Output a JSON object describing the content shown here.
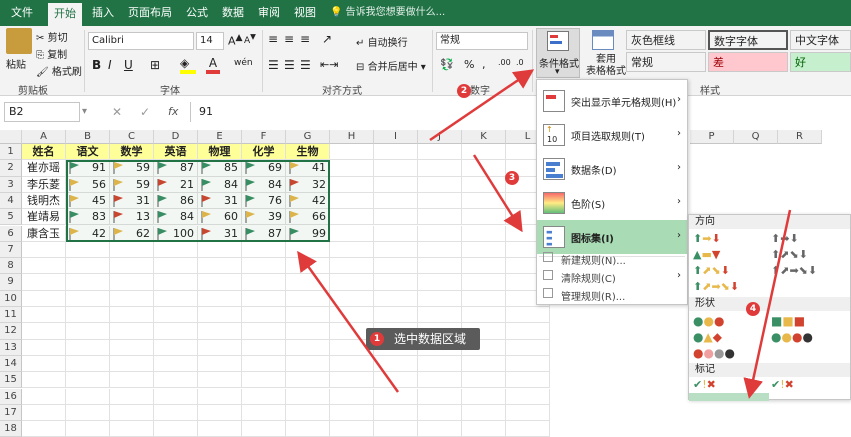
{
  "tabs": [
    "文件",
    "开始",
    "插入",
    "页面布局",
    "公式",
    "数据",
    "审阅",
    "视图"
  ],
  "tell_me": "告诉我您想要做什么...",
  "ribbon": {
    "paste": "粘贴",
    "cut": "剪切",
    "copy": "复制",
    "format_painter": "格式刷",
    "clipboard": "剪贴板",
    "font_name": "Calibri",
    "font_size": "14",
    "font_group": "字体",
    "wrap": "自动换行",
    "merge": "合并后居中",
    "align_group": "对齐方式",
    "number_format": "常规",
    "number_group": "数字",
    "cond_format": "条件格式",
    "table_format": "套用\n表格格式",
    "styles_group": "样式",
    "styles": [
      {
        "label": "灰色框线",
        "bg": "#ffffff",
        "color": "#222222"
      },
      {
        "label": "数字字体",
        "bg": "#ffffff",
        "color": "#222222"
      },
      {
        "label": "中文字体",
        "bg": "#ffffff",
        "color": "#222222"
      },
      {
        "label": "常规",
        "bg": "#ffffff",
        "color": "#222222"
      },
      {
        "label": "差",
        "bg": "#ffc7ce",
        "color": "#9c0006"
      },
      {
        "label": "好",
        "bg": "#c6efce",
        "color": "#006100"
      }
    ]
  },
  "formula_bar": {
    "name_box": "B2",
    "value": "91"
  },
  "columns": [
    "A",
    "B",
    "C",
    "D",
    "E",
    "F",
    "G",
    "H",
    "I",
    "J",
    "K",
    "L"
  ],
  "rows": [
    "1",
    "2",
    "3",
    "4",
    "5",
    "6",
    "7",
    "8",
    "9",
    "10",
    "11",
    "12",
    "13",
    "14",
    "15",
    "16",
    "17",
    "18"
  ],
  "table": {
    "headers": [
      "姓名",
      "语文",
      "数学",
      "英语",
      "物理",
      "化学",
      "生物"
    ],
    "data": [
      {
        "name": "崔亦瑶",
        "values": [
          91,
          59,
          87,
          85,
          69,
          41
        ]
      },
      {
        "name": "李乐菱",
        "values": [
          56,
          59,
          21,
          84,
          84,
          32
        ]
      },
      {
        "name": "钱明杰",
        "values": [
          45,
          31,
          86,
          31,
          76,
          42
        ]
      },
      {
        "name": "崔靖易",
        "values": [
          83,
          13,
          84,
          60,
          39,
          66
        ]
      },
      {
        "name": "康含玉",
        "values": [
          42,
          62,
          100,
          31,
          87,
          99
        ]
      }
    ]
  },
  "cond_menu": [
    {
      "label": "突出显示单元格规则(H)"
    },
    {
      "label": "项目选取规则(T)"
    },
    {
      "label": "数据条(D)"
    },
    {
      "label": "色阶(S)"
    },
    {
      "label": "图标集(I)"
    }
  ],
  "cond_menu_extra": [
    "新建规则(N)...",
    "清除规则(C)",
    "管理规则(R)..."
  ],
  "icon_submenu": {
    "direction": "方向",
    "shapes": "形状",
    "marks": "标记"
  },
  "right_cols": [
    "P",
    "Q",
    "R"
  ],
  "annotation": {
    "label": "选中数据区域"
  },
  "badges": [
    "1",
    "2",
    "3",
    "4"
  ],
  "colors": {
    "green": "#217346",
    "flag_green": "#3b8f64",
    "flag_yellow": "#e8b84a",
    "flag_red": "#d2432f",
    "header_yellow": "#ffff99"
  }
}
